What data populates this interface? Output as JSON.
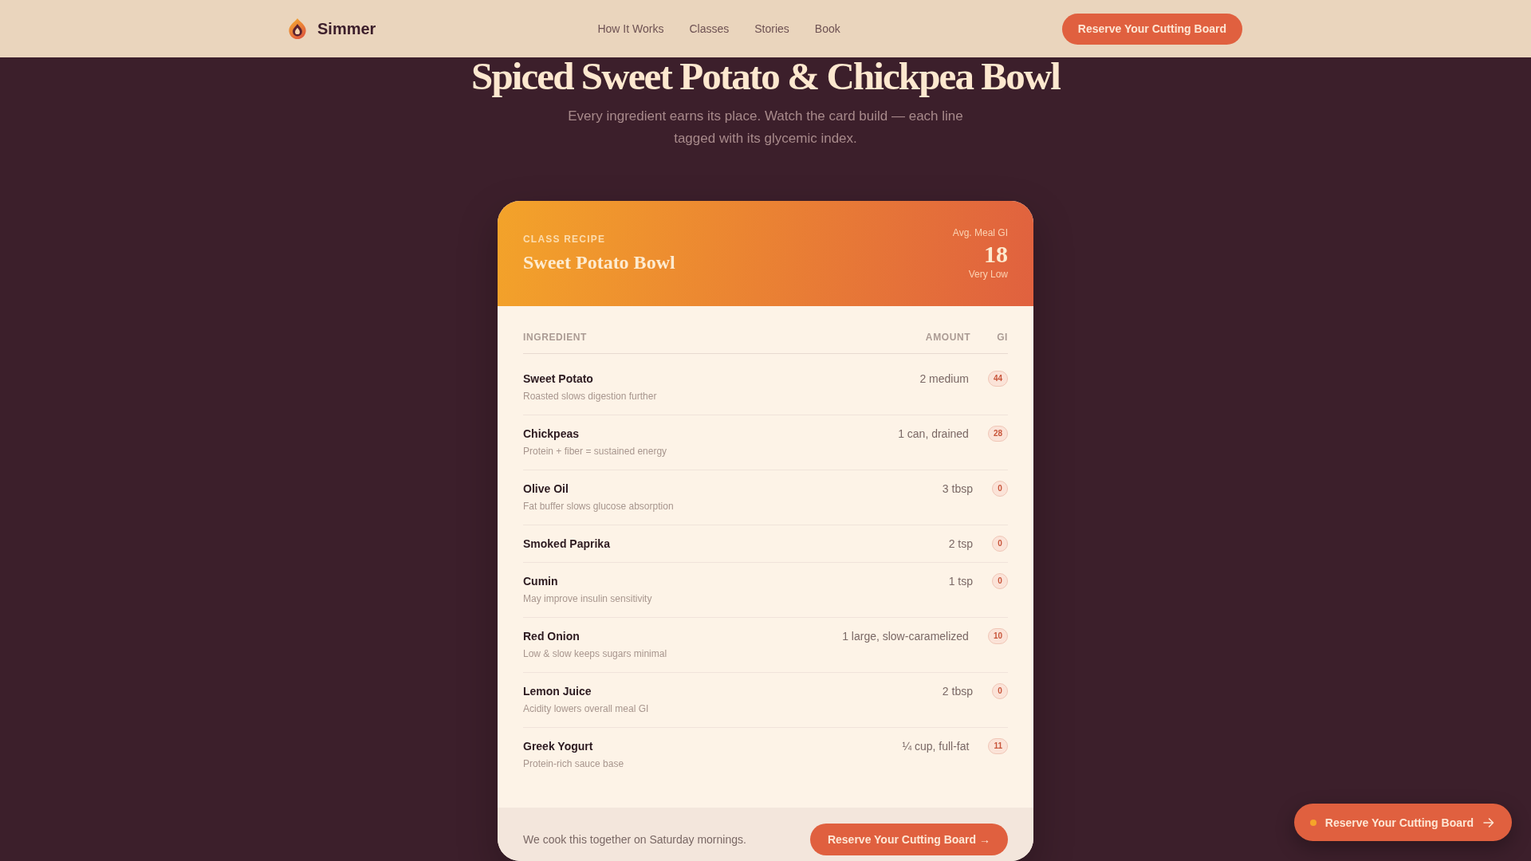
{
  "nav": {
    "brand": "Simmer",
    "links": [
      "How It Works",
      "Classes",
      "Stories",
      "Book"
    ],
    "button": "Reserve Your Cutting Board"
  },
  "hero": {
    "title": "Spiced Sweet Potato & Chickpea Bowl",
    "subtitle": "Every ingredient earns its place. Watch the card build — each line tagged with its glycemic index."
  },
  "recipe_card": {
    "eyebrow": "CLASS RECIPE",
    "title": "Sweet Potato Bowl",
    "avg_gi": {
      "label": "Avg. Meal GI",
      "value": "18",
      "rating": "Very Low"
    },
    "columns": [
      "INGREDIENT",
      "AMOUNT",
      "GI"
    ],
    "ingredients": [
      {
        "name": "Sweet Potato",
        "note": "Roasted slows digestion further",
        "amount": "2 medium",
        "gi": "44"
      },
      {
        "name": "Chickpeas",
        "note": "Protein + fiber = sustained energy",
        "amount": "1 can, drained",
        "gi": "28"
      },
      {
        "name": "Olive Oil",
        "note": "Fat buffer slows glucose absorption",
        "amount": "3 tbsp",
        "gi": "0"
      },
      {
        "name": "Smoked Paprika",
        "amount": "2 tsp",
        "gi": "0"
      },
      {
        "name": "Cumin",
        "note": "May improve insulin sensitivity",
        "amount": "1 tsp",
        "gi": "0"
      },
      {
        "name": "Red Onion",
        "note": "Low & slow keeps sugars minimal",
        "amount": "1 large, slow-caramelized",
        "gi": "10"
      },
      {
        "name": "Lemon Juice",
        "note": "Acidity lowers overall meal GI",
        "amount": "2 tbsp",
        "gi": "0"
      },
      {
        "name": "Greek Yogurt",
        "note": "Protein-rich sauce base",
        "amount": "¼ cup, full-fat",
        "gi": "11"
      }
    ],
    "footer": {
      "text": "We cook this together on Saturday mornings.",
      "button": "Reserve Your Cutting Board →"
    }
  },
  "floating_button": {
    "label": "Reserve Your Cutting Board"
  }
}
